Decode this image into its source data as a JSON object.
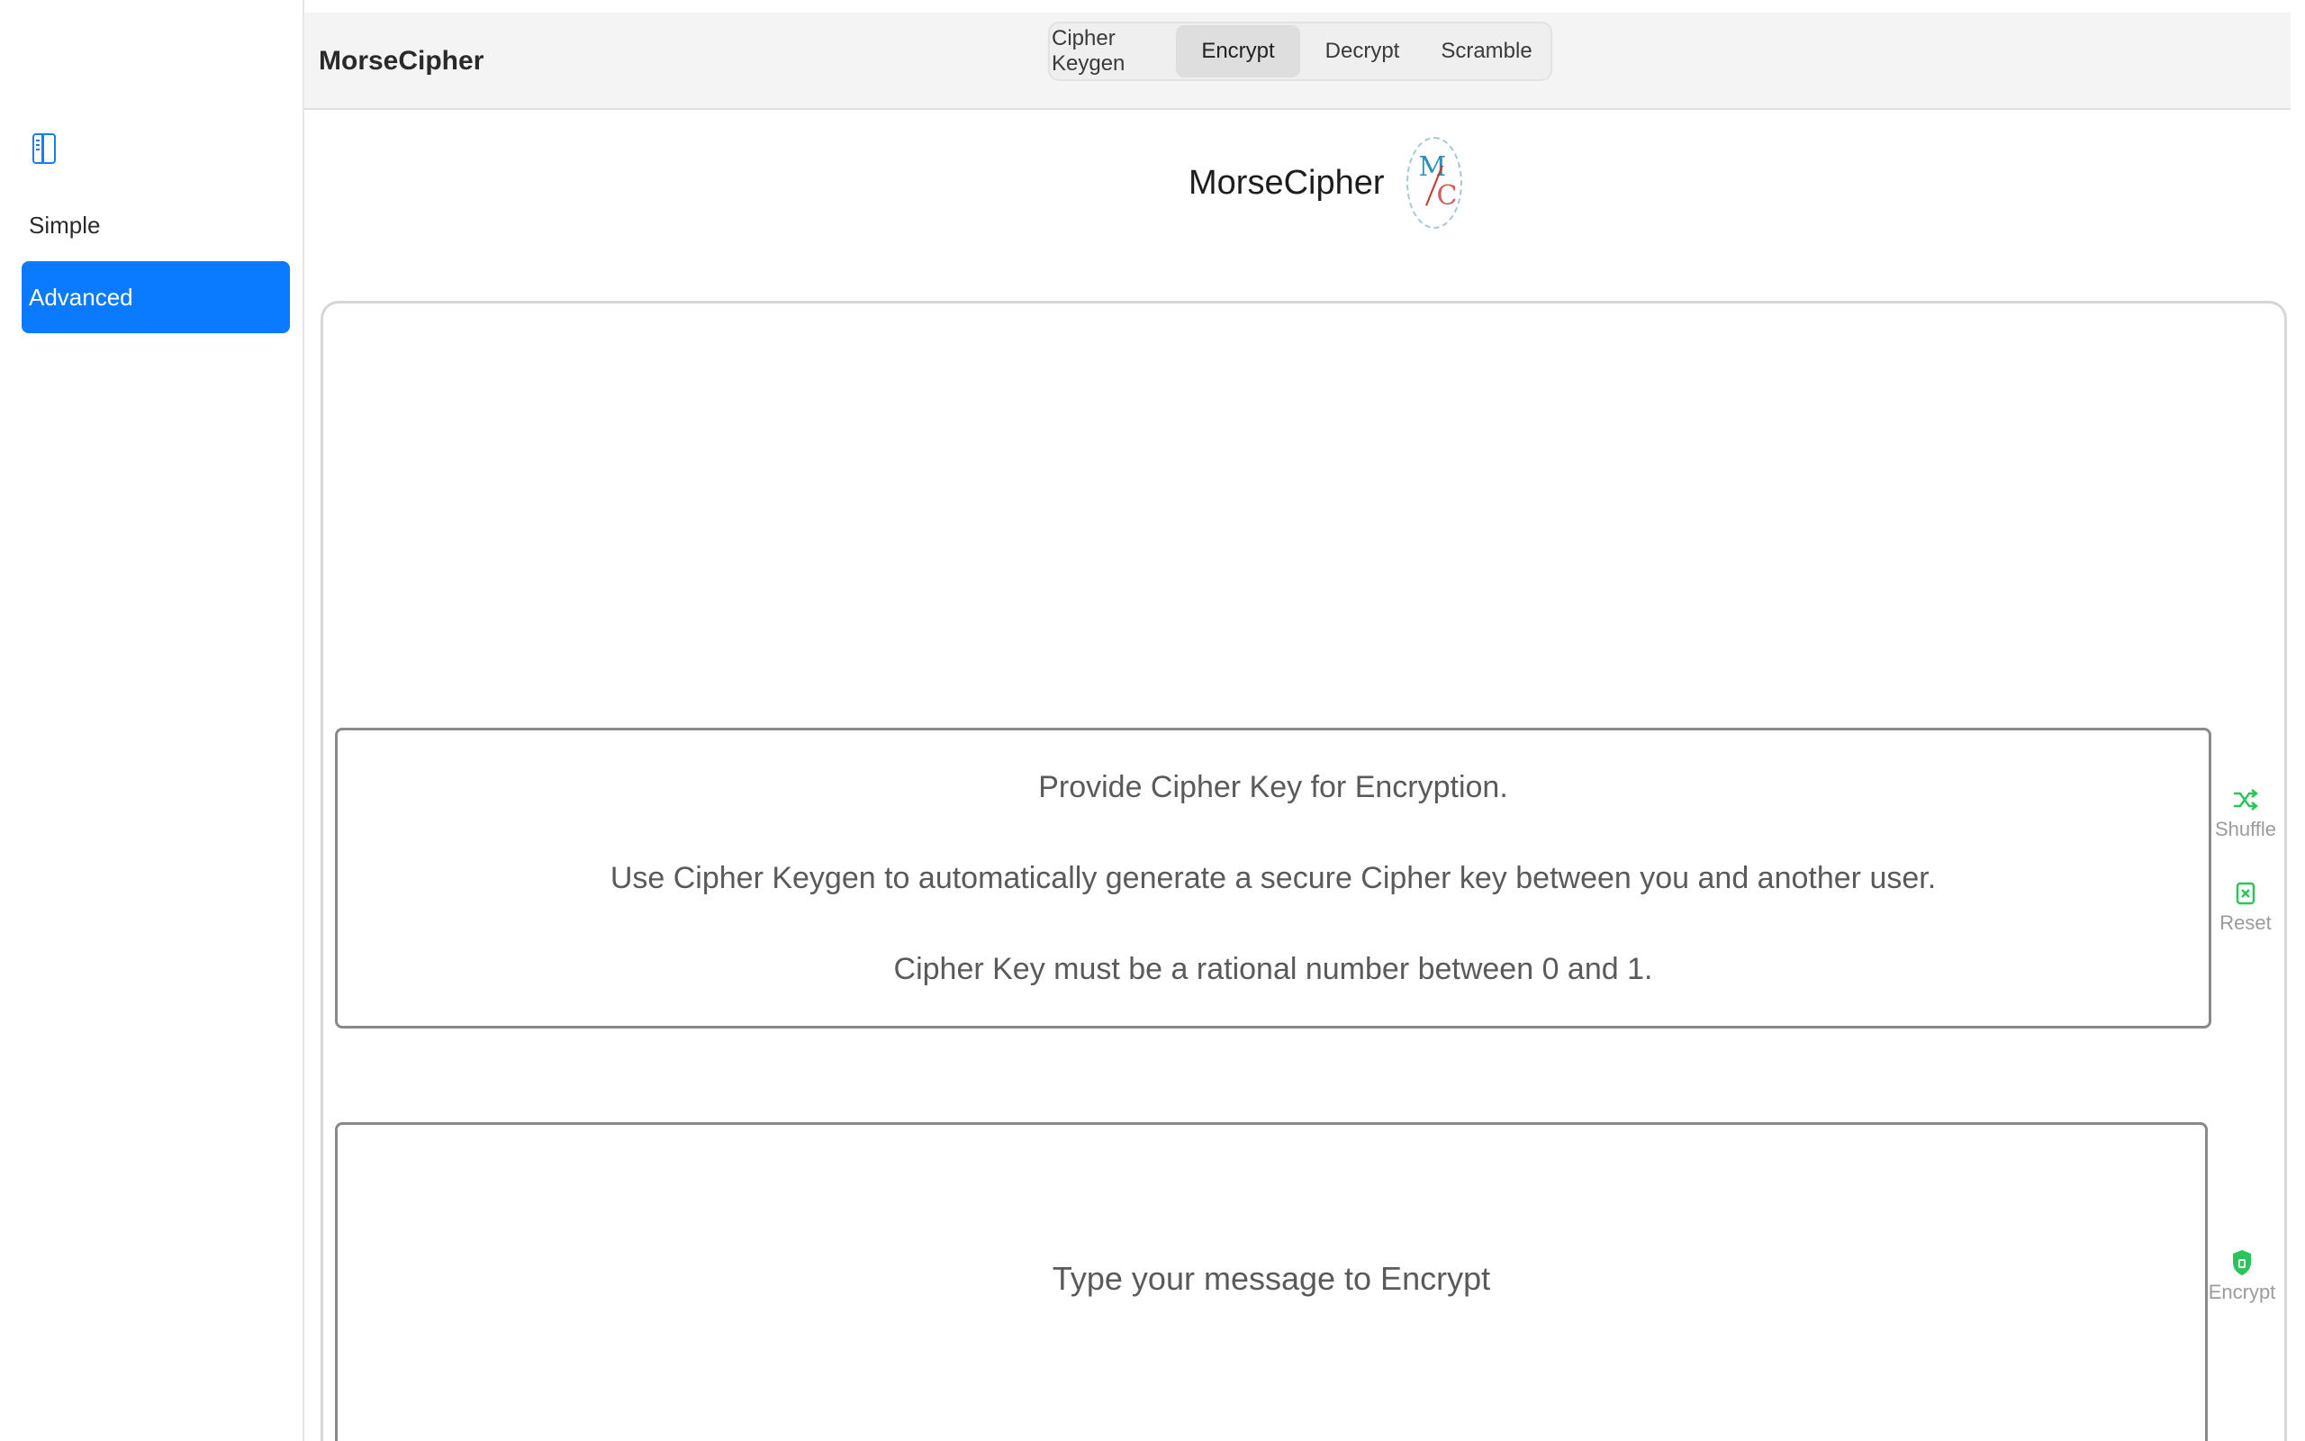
{
  "app": {
    "title": "MorseCipher"
  },
  "sidebar": {
    "items": [
      {
        "label": "Simple"
      },
      {
        "label": "Advanced",
        "selected": true
      }
    ],
    "accent": "#0a7bff"
  },
  "toolbar": {
    "segments": [
      {
        "label": "Cipher Keygen"
      },
      {
        "label": "Encrypt",
        "selected": true
      },
      {
        "label": "Decrypt"
      },
      {
        "label": "Scramble"
      }
    ]
  },
  "header": {
    "brand_name": "MorseCipher",
    "logo": {
      "letter_top": "M",
      "letter_bottom": "C"
    }
  },
  "cipher_key": {
    "line1": "Provide Cipher Key for Encryption.",
    "line2": "Use Cipher Keygen to automatically generate a secure Cipher key between you and another user.",
    "line3": "Cipher Key must be a rational number between 0 and 1."
  },
  "message": {
    "placeholder": "Type your message to Encrypt"
  },
  "actions": {
    "shuffle": {
      "label": "Shuffle",
      "icon": "shuffle-icon"
    },
    "reset": {
      "label": "Reset",
      "icon": "reset-icon"
    },
    "encrypt": {
      "label": "Encrypt",
      "icon": "shield-icon"
    },
    "icon_color": "#2bc45a"
  }
}
